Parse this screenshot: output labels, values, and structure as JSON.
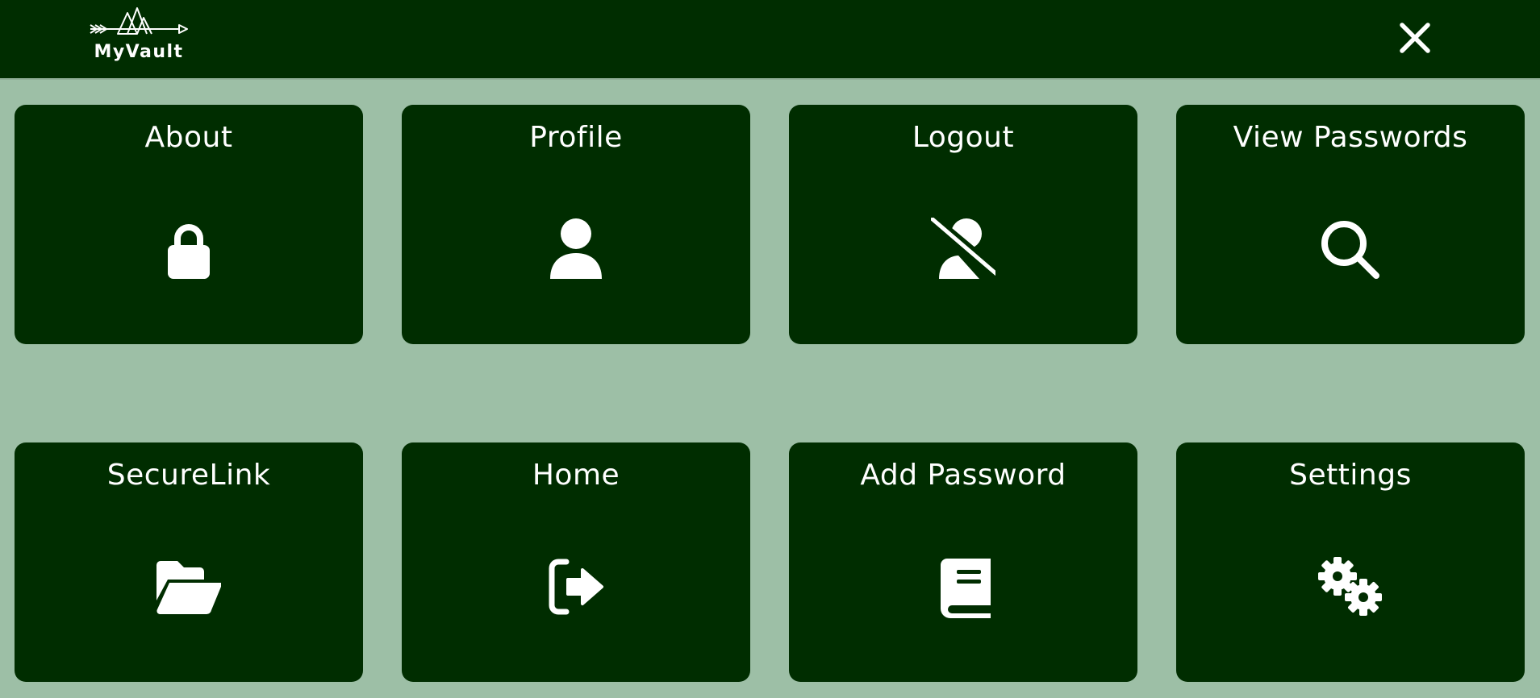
{
  "app": {
    "name": "MyVault",
    "close_icon": "close-icon"
  },
  "colors": {
    "background": "#9dbfa6",
    "tile": "#002d00",
    "header": "#002d00",
    "text": "#ffffff"
  },
  "tiles": [
    {
      "label": "About",
      "icon": "lock-icon"
    },
    {
      "label": "Profile",
      "icon": "user-icon"
    },
    {
      "label": "Logout",
      "icon": "user-slash-icon"
    },
    {
      "label": "View Passwords",
      "icon": "search-icon"
    },
    {
      "label": "SecureLink",
      "icon": "folder-open-icon"
    },
    {
      "label": "Home",
      "icon": "sign-out-icon"
    },
    {
      "label": "Add Password",
      "icon": "book-icon"
    },
    {
      "label": "Settings",
      "icon": "gears-icon"
    }
  ]
}
